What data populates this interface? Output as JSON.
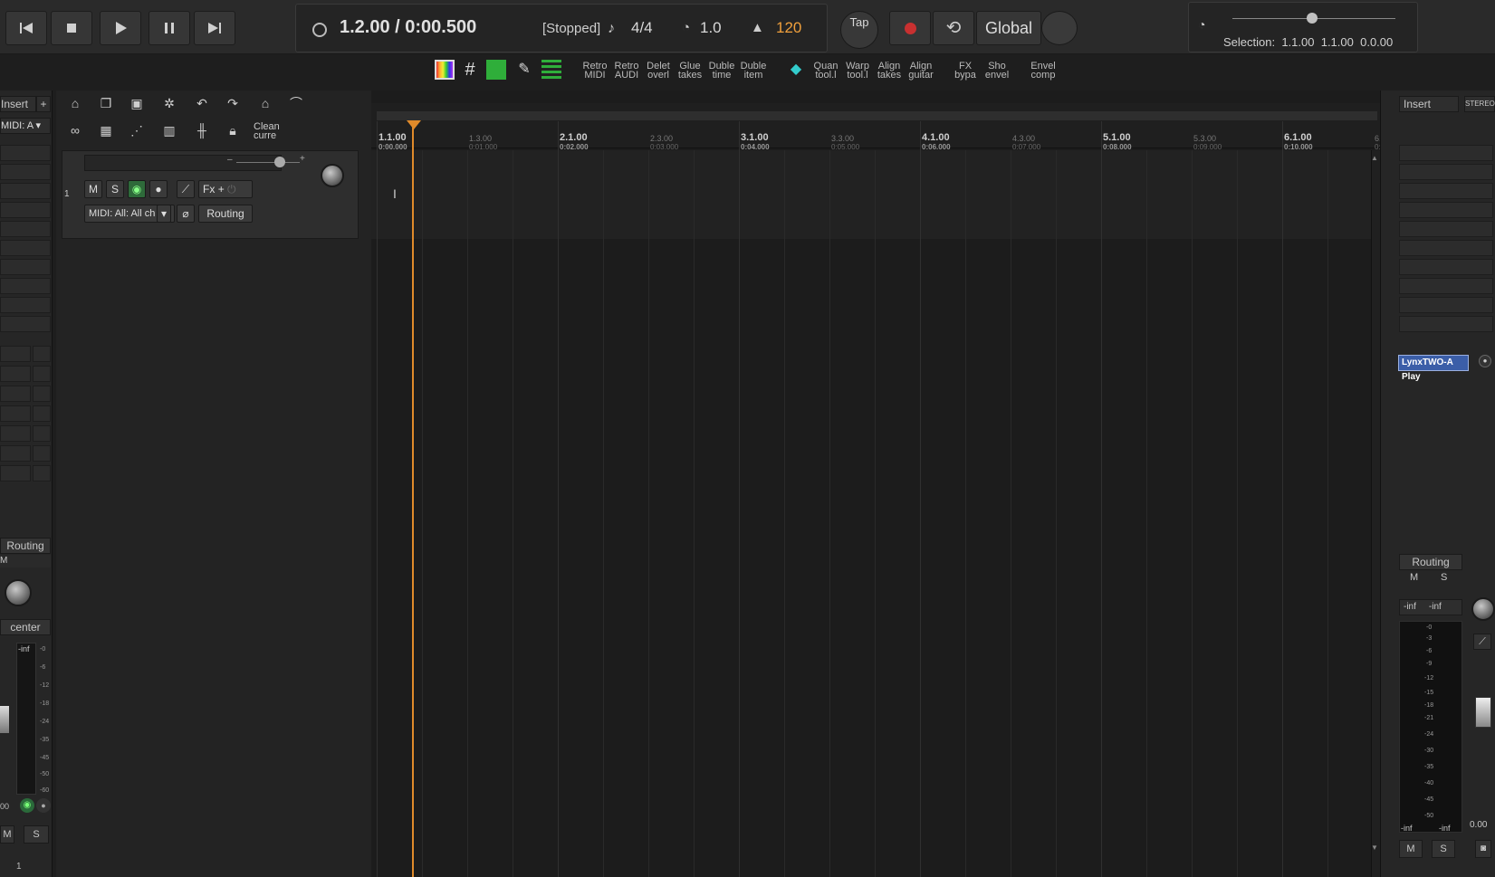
{
  "transport": {
    "time": "1.2.00 / 0:00.500",
    "status": "[Stopped]",
    "time_signature": "4/4",
    "playrate": "1.0",
    "tempo": "120",
    "tap_label": "Tap",
    "global_label": "Global",
    "selection_label": "Selection:",
    "selection_start": "1.1.00",
    "selection_end": "1.1.00",
    "selection_length": "0.0.00"
  },
  "actions": [
    {
      "label_1": "Retro",
      "label_2": "MIDI"
    },
    {
      "label_1": "Retro",
      "label_2": "AUDI"
    },
    {
      "label_1": "Delet",
      "label_2": "overl"
    },
    {
      "label_1": "Glue",
      "label_2": "takes"
    },
    {
      "label_1": "Duble",
      "label_2": "time"
    },
    {
      "label_1": "Duble",
      "label_2": "item"
    },
    {
      "label_1": "Quan",
      "label_2": "tool.l"
    },
    {
      "label_1": "Warp",
      "label_2": "tool.l"
    },
    {
      "label_1": "Align",
      "label_2": "takes"
    },
    {
      "label_1": "Align",
      "label_2": "guitar"
    },
    {
      "label_1": "FX",
      "label_2": "bypa"
    },
    {
      "label_1": "Sho",
      "label_2": "envel"
    },
    {
      "label_1": "Envel",
      "label_2": "comp"
    }
  ],
  "tcp_toolbar": {
    "clean_label_1": "Clean",
    "clean_label_2": "curre"
  },
  "left_panel": {
    "insert_label": "Insert",
    "plus": "+",
    "midi_label": "MIDI: A",
    "routing_label": "Routing",
    "m_label": "M",
    "center_label": "center",
    "inf_label": "-inf",
    "mute_label": "M",
    "solo_label": "S",
    "value_label": "00",
    "track_number": "1",
    "scale": [
      "-0",
      "-6",
      "-12",
      "-18",
      "-24",
      "-35",
      "-45",
      "-50",
      "-60"
    ]
  },
  "track": {
    "number": "1",
    "mute_label": "M",
    "solo_label": "S",
    "fx_label": "Fx",
    "fx_plus": "+",
    "input_label": "MIDI: All: All ch",
    "routing_label": "Routing",
    "volume_minus": "–",
    "volume_plus": "+"
  },
  "ruler": {
    "bars": [
      {
        "label": "1.1.00",
        "time": "0:00.000"
      },
      {
        "label": "2.1.00",
        "time": "0:02.000"
      },
      {
        "label": "3.1.00",
        "time": "0:04.000"
      },
      {
        "label": "4.1.00",
        "time": "0:06.000"
      },
      {
        "label": "5.1.00",
        "time": "0:08.000"
      },
      {
        "label": "6.1.00",
        "time": "0:10.000"
      }
    ],
    "beats": [
      {
        "label": "1.3.00",
        "time": "0:01.000"
      },
      {
        "label": "2.3.00",
        "time": "0:03.000"
      },
      {
        "label": "3.3.00",
        "time": "0:05.000"
      },
      {
        "label": "4.3.00",
        "time": "0:07.000"
      },
      {
        "label": "5.3.00",
        "time": "0:09.000"
      }
    ],
    "edge_label": "6.3",
    "edge_time": "0:1"
  },
  "mixer": {
    "insert_label": "Insert",
    "stereo_label": "STEREO",
    "output_label": "LynxTWO-A Play",
    "routing_label": "Routing",
    "m_label": "M",
    "s_label": "S",
    "peak_left": "-inf",
    "peak_right": "-inf",
    "bottom_left": "-inf",
    "bottom_right": "-inf",
    "volume_value": "0.00",
    "scale": [
      "-0",
      "-3",
      "-6",
      "-9",
      "-12",
      "-15",
      "-18",
      "-21",
      "-24",
      "-30",
      "-35",
      "-40",
      "-45",
      "-50"
    ]
  },
  "colors": {
    "cursor": "#e08a2a",
    "tempo": "#f0a03c",
    "record": "#c83030",
    "output_highlight": "#3b5ea8"
  }
}
